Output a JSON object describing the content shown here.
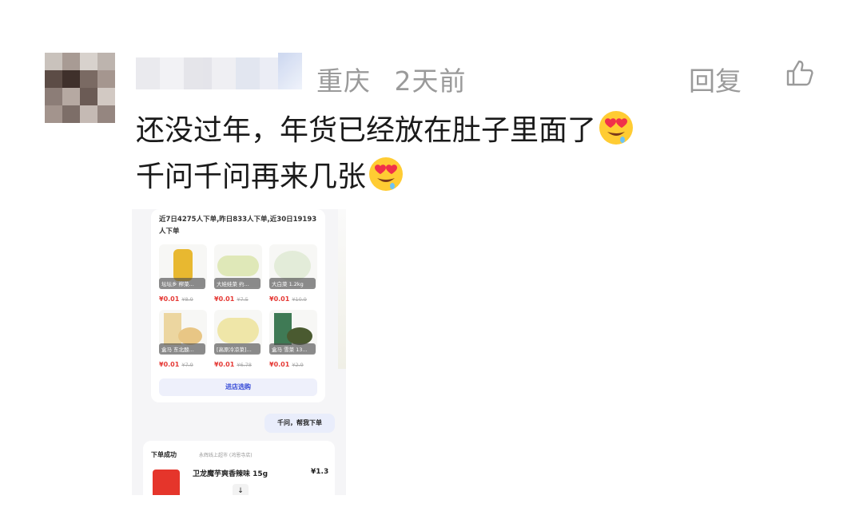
{
  "comment": {
    "location": "重庆",
    "time": "2天前",
    "reply_label": "回复",
    "text_line1": "还没过年，年货已经放在肚子里面了",
    "text_line2": "千问千问再来几张",
    "emoji": "heart-eyes-drool-face"
  },
  "screenshot": {
    "order_info": "近7日4275人下单,昨日833人下单,近30日19193人下单",
    "products": [
      {
        "name": "坛坛乡 榨菜...",
        "price": "¥0.01",
        "original": "¥8.9"
      },
      {
        "name": "大娃娃菜 约...",
        "price": "¥0.01",
        "original": "¥7.5"
      },
      {
        "name": "大白菜 1.2kg",
        "price": "¥0.01",
        "original": "¥10.9"
      },
      {
        "name": "盒马 东北酸...",
        "price": "¥0.01",
        "original": "¥7.9"
      },
      {
        "name": "[高原冷凉菜]...",
        "price": "¥0.01",
        "original": "¥6.78"
      },
      {
        "name": "盒马 雪菜 13...",
        "price": "¥0.01",
        "original": "¥2.9"
      }
    ],
    "store_button": "进店选购",
    "chat_bubble": "千问，帮我下单",
    "order_success": "下单成功",
    "store_name": "永辉线上超市 (鸿恩寺店)",
    "order_item": "卫龙魔芋爽香辣味 15g",
    "order_price": "¥1.3"
  },
  "colors": {
    "meta_gray": "#9a9a9a",
    "price_red": "#e53935",
    "accent_blue": "#3b4fd8"
  }
}
